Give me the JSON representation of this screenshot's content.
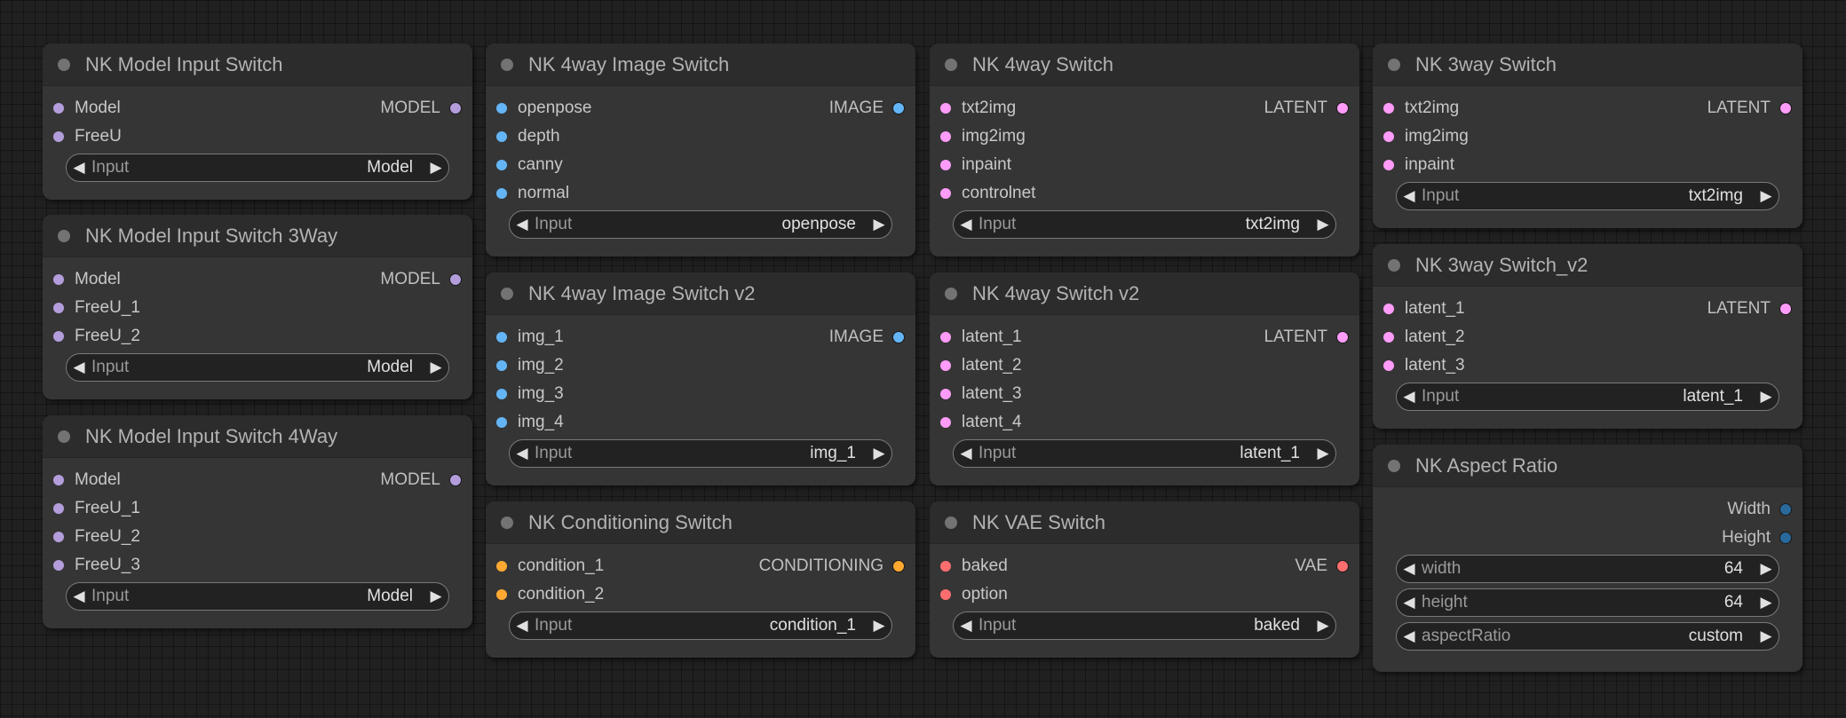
{
  "colors": {
    "model": "#b39ddb",
    "image": "#64b5f6",
    "latent": "#ff9cf9",
    "conditioning": "#ffa931",
    "vae": "#ff6e6e",
    "int": "#29699c"
  },
  "icons": {
    "left_arrow": "◀",
    "right_arrow": "▶"
  },
  "nodes": {
    "model_switch": {
      "title": "NK Model Input Switch",
      "inputs": [
        "Model",
        "FreeU"
      ],
      "output": "MODEL",
      "widget": {
        "label": "Input",
        "value": "Model"
      }
    },
    "model_switch_3way": {
      "title": "NK Model Input Switch 3Way",
      "inputs": [
        "Model",
        "FreeU_1",
        "FreeU_2"
      ],
      "output": "MODEL",
      "widget": {
        "label": "Input",
        "value": "Model"
      }
    },
    "model_switch_4way": {
      "title": "NK Model Input Switch 4Way",
      "inputs": [
        "Model",
        "FreeU_1",
        "FreeU_2",
        "FreeU_3"
      ],
      "output": "MODEL",
      "widget": {
        "label": "Input",
        "value": "Model"
      }
    },
    "image_4way": {
      "title": "NK 4way Image Switch",
      "inputs": [
        "openpose",
        "depth",
        "canny",
        "normal"
      ],
      "output": "IMAGE",
      "widget": {
        "label": "Input",
        "value": "openpose"
      }
    },
    "image_4way_v2": {
      "title": "NK 4way Image Switch v2",
      "inputs": [
        "img_1",
        "img_2",
        "img_3",
        "img_4"
      ],
      "output": "IMAGE",
      "widget": {
        "label": "Input",
        "value": "img_1"
      }
    },
    "conditioning_switch": {
      "title": "NK Conditioning Switch",
      "inputs": [
        "condition_1",
        "condition_2"
      ],
      "output": "CONDITIONING",
      "widget": {
        "label": "Input",
        "value": "condition_1"
      }
    },
    "switch_4way": {
      "title": "NK 4way Switch",
      "inputs": [
        "txt2img",
        "img2img",
        "inpaint",
        "controlnet"
      ],
      "output": "LATENT",
      "widget": {
        "label": "Input",
        "value": "txt2img"
      }
    },
    "switch_4way_v2": {
      "title": "NK 4way Switch v2",
      "inputs": [
        "latent_1",
        "latent_2",
        "latent_3",
        "latent_4"
      ],
      "output": "LATENT",
      "widget": {
        "label": "Input",
        "value": "latent_1"
      }
    },
    "vae_switch": {
      "title": "NK VAE Switch",
      "inputs": [
        "baked",
        "option"
      ],
      "output": "VAE",
      "widget": {
        "label": "Input",
        "value": "baked"
      }
    },
    "switch_3way": {
      "title": "NK 3way Switch",
      "inputs": [
        "txt2img",
        "img2img",
        "inpaint"
      ],
      "output": "LATENT",
      "widget": {
        "label": "Input",
        "value": "txt2img"
      }
    },
    "switch_3way_v2": {
      "title": "NK 3way Switch_v2",
      "inputs": [
        "latent_1",
        "latent_2",
        "latent_3"
      ],
      "output": "LATENT",
      "widget": {
        "label": "Input",
        "value": "latent_1"
      }
    },
    "aspect_ratio": {
      "title": "NK Aspect Ratio",
      "outputs": [
        "Width",
        "Height"
      ],
      "widgets": [
        {
          "label": "width",
          "value": "64"
        },
        {
          "label": "height",
          "value": "64"
        },
        {
          "label": "aspectRatio",
          "value": "custom"
        }
      ]
    }
  }
}
